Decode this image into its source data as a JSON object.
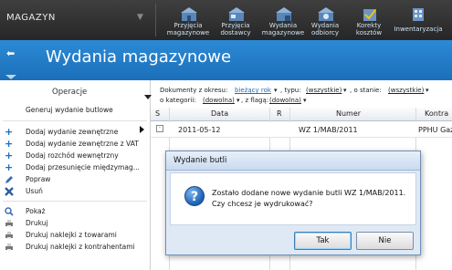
{
  "module": {
    "title": "MAGAZYN"
  },
  "toolbar": [
    {
      "label": "Przyjęcia\nmagazynowe",
      "icon": "warehouse-in-icon"
    },
    {
      "label": "Przyjęcia\ndostawcy",
      "icon": "supplier-delivery-icon"
    },
    {
      "label": "Wydania\nmagazynowe",
      "icon": "warehouse-out-icon"
    },
    {
      "label": "Wydania\nodbiorcy",
      "icon": "customer-delivery-icon"
    },
    {
      "label": "Korekty\nkosztów",
      "icon": "cost-correction-icon"
    },
    {
      "label": "Inwentaryzacja",
      "icon": "inventory-icon"
    }
  ],
  "header": {
    "title": "Wydania magazynowe"
  },
  "operations": {
    "title": "Operacje",
    "generate": "Generuj wydanie butlowe",
    "items": [
      "Dodaj wydanie zewnętrzne",
      "Dodaj wydanie zewnętrzne z VAT",
      "Dodaj rozchód wewnętrzny",
      "Dodaj przesunięcie międzymag...",
      "Popraw",
      "Usuń"
    ],
    "items2": [
      "Pokaż",
      "Drukuj",
      "Drukuj naklejki z towarami",
      "Drukuj naklejki z kontrahentami"
    ]
  },
  "filters": {
    "period_label": "Dokumenty z okresu:",
    "period_value": "bieżący rok",
    "type_label": ", typu:",
    "type_value": "(wszystkie)",
    "state_label": ", o stanie:",
    "state_value": "(wszystkie)",
    "category_label": "o kategorii:",
    "category_value": "(dowolna)",
    "flag_label": ", z flagą:",
    "flag_value": "(dowolna)"
  },
  "grid": {
    "columns": [
      "S",
      "Data",
      "R",
      "Numer",
      "Kontra"
    ],
    "rows": [
      {
        "date": "2011-05-12",
        "number": "WZ 1/MAB/2011",
        "contractor": "PPHU Gaz"
      }
    ]
  },
  "dialog": {
    "title": "Wydanie butli",
    "line1": "Zostało dodane nowe wydanie butli WZ 1/MAB/2011.",
    "line2": "Czy chcesz je wydrukować?",
    "yes": "Tak",
    "no": "Nie"
  },
  "colors": {
    "header": "#1c6fb8",
    "toolbar": "#2a2a2a",
    "accent": "#1d6dbd"
  }
}
